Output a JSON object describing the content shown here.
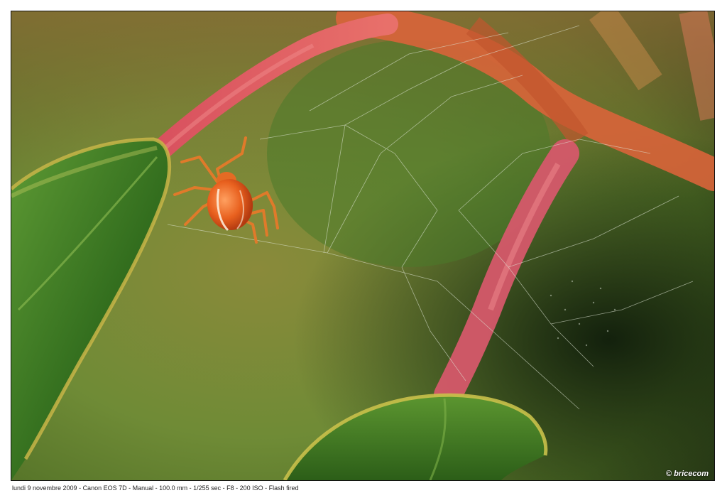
{
  "photo": {
    "subject": "orange-spider-on-web",
    "copyright": "© bricecom"
  },
  "caption": {
    "text": "lundi 9 novembre 2009 - Canon EOS 7D - Manual - 100.0 mm - 1/255 sec - F8 - 200 ISO - Flash fired"
  },
  "colors": {
    "background_green": "#7a9440",
    "leaf_green": "#3f7a22",
    "stem_pink": "#e0606a",
    "spider_orange": "#e8601e"
  }
}
